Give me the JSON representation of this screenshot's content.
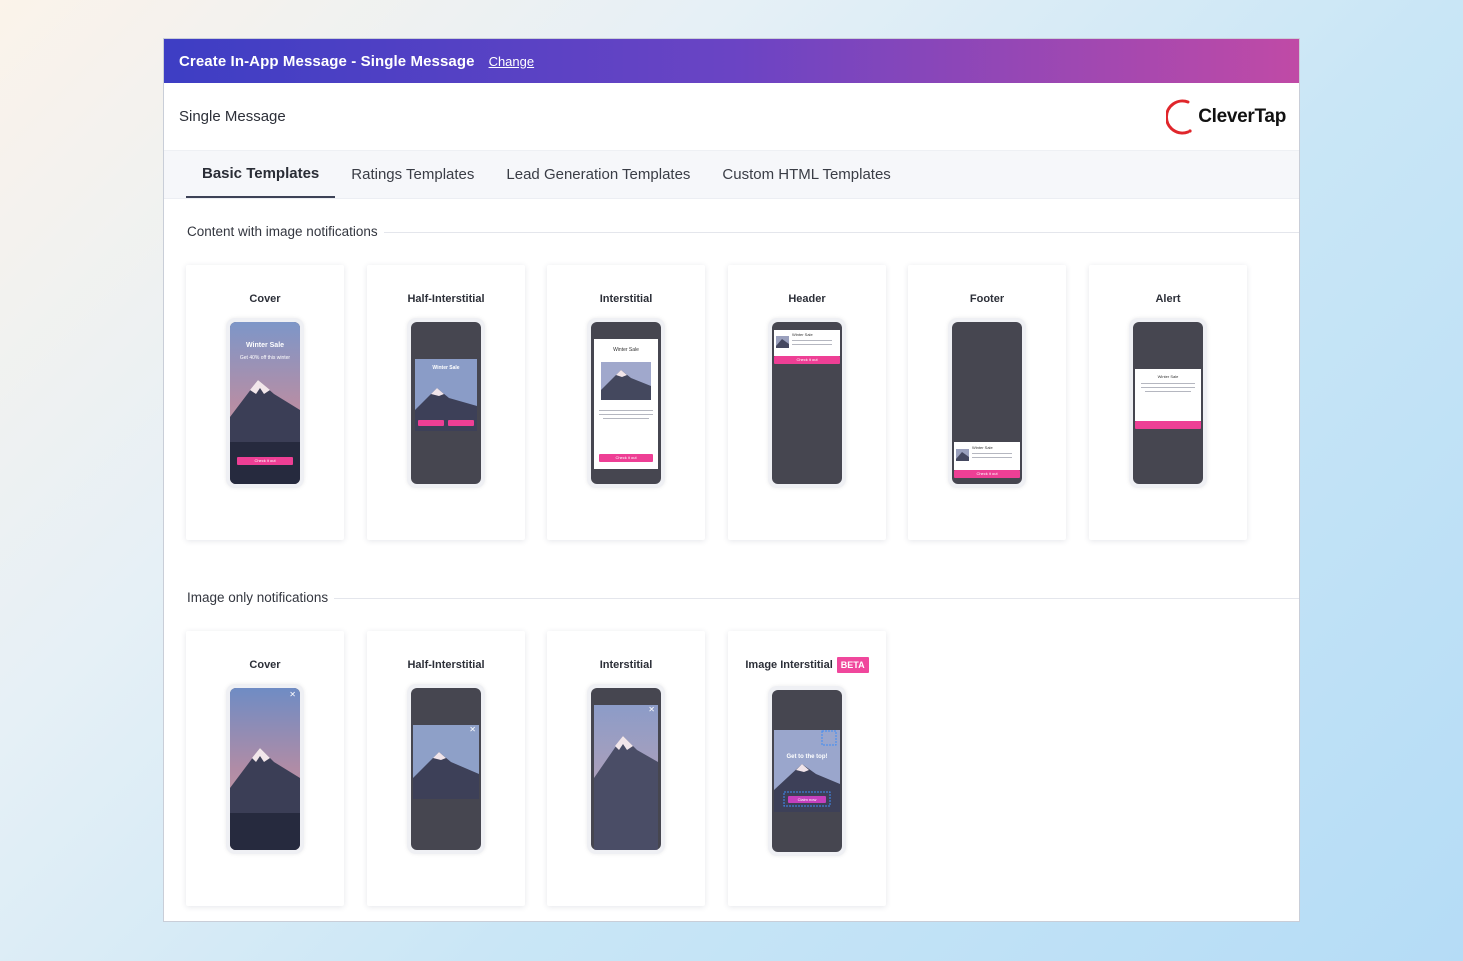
{
  "window": {
    "title": "Create In-App Message - Single Message",
    "change_link": "Change",
    "subtitle": "Single Message",
    "logo_text": "CleverTap"
  },
  "tabs": [
    {
      "label": "Basic Templates",
      "active": true
    },
    {
      "label": "Ratings Templates",
      "active": false
    },
    {
      "label": "Lead Generation Templates",
      "active": false
    },
    {
      "label": "Custom HTML Templates",
      "active": false
    }
  ],
  "sections": {
    "content_with_image": {
      "title": "Content with image notifications",
      "cards": [
        {
          "label": "Cover",
          "preview_title": "Winter Sale",
          "preview_sub": "Get 40% off this winter",
          "preview_button": "Check it out"
        },
        {
          "label": "Half-Interstitial",
          "preview_title": "Winter Sale"
        },
        {
          "label": "Interstitial",
          "preview_title": "Winter Sale",
          "preview_button": "Check it out"
        },
        {
          "label": "Header",
          "preview_title": "Winter Sale",
          "preview_button": "Check it out"
        },
        {
          "label": "Footer",
          "preview_title": "Winter Sale",
          "preview_button": "Check it out"
        },
        {
          "label": "Alert",
          "preview_title": "Winter Sale"
        }
      ]
    },
    "image_only": {
      "title": "Image only notifications",
      "cards": [
        {
          "label": "Cover"
        },
        {
          "label": "Half-Interstitial"
        },
        {
          "label": "Interstitial"
        },
        {
          "label": "Image Interstitial",
          "badge": "BETA",
          "preview_title": "Get to the top!",
          "preview_button": "Claim now"
        }
      ]
    }
  },
  "colors": {
    "accent_pink": "#ee3f95",
    "title_gradient_start": "#3d3ec4",
    "title_gradient_end": "#c04aa6",
    "phone_screen": "#464650"
  }
}
